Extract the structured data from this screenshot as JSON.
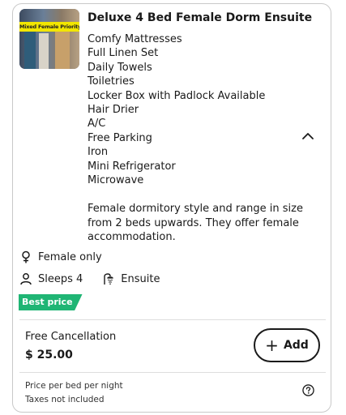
{
  "room": {
    "title": "Deluxe 4 Bed Female Dorm Ensuite",
    "image_banner": "Mixed Female Priority",
    "amenities": [
      "Comfy Mattresses",
      "Full Linen Set",
      "Daily Towels",
      "Toiletries",
      "Locker Box with Padlock Available",
      "Hair Drier",
      "A/C",
      "Free Parking",
      "Iron",
      "Mini Refrigerator",
      "Microwave"
    ],
    "description": "Female dormitory style and range in size from 2 beds upwards.  They offer female accommodation.",
    "features": {
      "gender": "Female only",
      "sleeps": "Sleeps 4",
      "bathroom": "Ensuite"
    },
    "badge": "Best price",
    "cancellation": "Free Cancellation",
    "price": "$ 25.00",
    "add_label": "Add",
    "price_note": "Price per bed per night",
    "tax_note": "Taxes not included"
  },
  "colors": {
    "badge_bg": "#1fb574",
    "banner_bg": "#f2e600",
    "border": "#c9c9c9",
    "text": "#1a1a1a"
  },
  "icons": {
    "collapse": "chevron-up-icon",
    "gender": "female-icon",
    "sleeps": "person-icon",
    "bathroom": "shower-icon",
    "add": "plus-icon",
    "help": "question-circle-icon"
  }
}
